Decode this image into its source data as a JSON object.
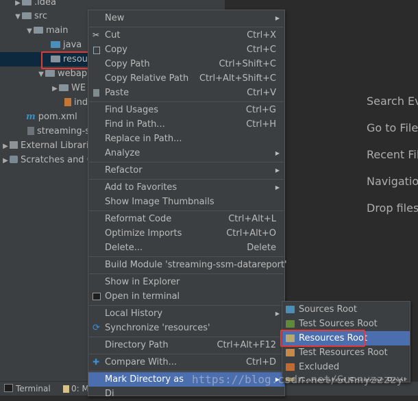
{
  "project_tree": {
    "rows": [
      {
        "label": ".idea",
        "type": "folder"
      },
      {
        "label": "src",
        "type": "folder"
      },
      {
        "label": "main",
        "type": "folder"
      },
      {
        "label": "java",
        "type": "folder-blue"
      },
      {
        "label": "resou",
        "type": "folder"
      },
      {
        "label": "webap",
        "type": "folder"
      },
      {
        "label": "WE",
        "type": "folder"
      },
      {
        "label": "ind",
        "type": "jsp"
      },
      {
        "label": "pom.xml",
        "type": "pom"
      },
      {
        "label": "streaming-ss",
        "type": "iml"
      },
      {
        "label": "External Librarie",
        "type": "lib"
      },
      {
        "label": "Scratches and C",
        "type": "scratch"
      }
    ]
  },
  "editor_hints": [
    "Search Eve",
    "Go to File",
    "Recent Fil",
    "Navigation",
    "Drop files"
  ],
  "context_menu": {
    "items": [
      {
        "label": "New",
        "shortcut": "",
        "submenu": true
      },
      {
        "label": "Cut",
        "shortcut": "Ctrl+X",
        "icon": "scissors-icon"
      },
      {
        "label": "Copy",
        "shortcut": "Ctrl+C",
        "icon": "copy-icon"
      },
      {
        "label": "Copy Path",
        "shortcut": "Ctrl+Shift+C"
      },
      {
        "label": "Copy Relative Path",
        "shortcut": "Ctrl+Alt+Shift+C"
      },
      {
        "label": "Paste",
        "shortcut": "Ctrl+V",
        "icon": "paste-icon"
      },
      {
        "label": "Find Usages",
        "shortcut": "Ctrl+G"
      },
      {
        "label": "Find in Path...",
        "shortcut": "Ctrl+H"
      },
      {
        "label": "Replace in Path...",
        "shortcut": ""
      },
      {
        "label": "Analyze",
        "shortcut": "",
        "submenu": true
      },
      {
        "label": "Refactor",
        "shortcut": "",
        "submenu": true
      },
      {
        "label": "Add to Favorites",
        "shortcut": "",
        "submenu": true
      },
      {
        "label": "Show Image Thumbnails",
        "shortcut": ""
      },
      {
        "label": "Reformat Code",
        "shortcut": "Ctrl+Alt+L"
      },
      {
        "label": "Optimize Imports",
        "shortcut": "Ctrl+Alt+O"
      },
      {
        "label": "Delete...",
        "shortcut": "Delete"
      },
      {
        "label": "Build Module 'streaming-ssm-datareport'",
        "shortcut": ""
      },
      {
        "label": "Show in Explorer",
        "shortcut": ""
      },
      {
        "label": "Open in terminal",
        "shortcut": "",
        "icon": "terminal-icon"
      },
      {
        "label": "Local History",
        "shortcut": "",
        "submenu": true
      },
      {
        "label": "Synchronize 'resources'",
        "shortcut": "",
        "icon": "sync-icon"
      },
      {
        "label": "Directory Path",
        "shortcut": "Ctrl+Alt+F12"
      },
      {
        "label": "Compare With...",
        "shortcut": "Ctrl+D",
        "icon": "compare-icon"
      },
      {
        "label": "Mark Directory as",
        "shortcut": "",
        "submenu": true,
        "highlighted": true
      },
      {
        "label": "Di",
        "shortcut": ""
      }
    ]
  },
  "submenu": {
    "items": [
      {
        "label": "Sources Root",
        "color": "#4b8fb8"
      },
      {
        "label": "Test Sources Root",
        "color": "#5f8a3c"
      },
      {
        "label": "Resources Root",
        "color": "#b7a870",
        "highlighted": true
      },
      {
        "label": "Test Resources Root",
        "color": "#c58a4a"
      },
      {
        "label": "Excluded",
        "color": "#c36a33"
      },
      {
        "label": "Generated Sources Root",
        "color": "#9a8b5c"
      }
    ]
  },
  "bottom_bar": {
    "terminal_label": "Terminal",
    "second_label": "0: M"
  },
  "watermark": "https://blog.csdn.net/Sunnyzzzzy",
  "colors": {
    "background": "#2b2b2b",
    "panel": "#3c3f41",
    "selection": "#4b6eaf",
    "highlight_box": "#e53935"
  }
}
